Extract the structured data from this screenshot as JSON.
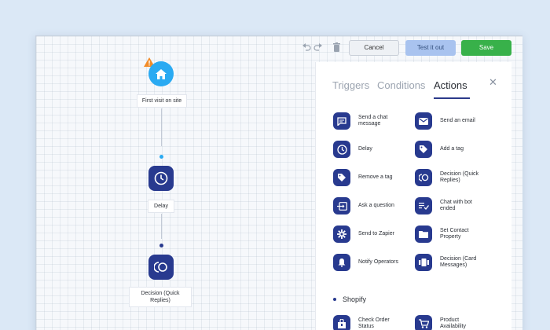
{
  "toolbar": {
    "undo_icon": "undo-icon",
    "redo_icon": "redo-icon",
    "trash_icon": "trash-icon",
    "cancel_label": "Cancel",
    "test_label": "Test it out",
    "save_label": "Save"
  },
  "flow": {
    "start_node": {
      "icon": "home-icon",
      "label": "First visit on site"
    },
    "delay_node": {
      "icon": "clock-icon",
      "label": "Delay"
    },
    "decision_node": {
      "icon": "decision-icon",
      "label_line1": "Decision (Quick",
      "label_line2": "Replies)"
    }
  },
  "panel": {
    "tabs": [
      {
        "label": "Triggers"
      },
      {
        "label": "Conditions"
      },
      {
        "label": "Actions",
        "active": true
      }
    ],
    "actions": [
      {
        "icon": "chat-icon",
        "line1": "Send a chat",
        "line2": "message"
      },
      {
        "icon": "email-icon",
        "line1": "Send an email",
        "line2": ""
      },
      {
        "icon": "clock-icon",
        "line1": "Delay",
        "line2": ""
      },
      {
        "icon": "tag-icon",
        "line1": "Add a tag",
        "line2": ""
      },
      {
        "icon": "tag-remove-icon",
        "line1": "Remove a tag",
        "line2": ""
      },
      {
        "icon": "decision-icon",
        "line1": "Decision (Quick",
        "line2": "Replies)"
      },
      {
        "icon": "question-icon",
        "line1": "Ask a question",
        "line2": ""
      },
      {
        "icon": "chat-bot-ended-icon",
        "line1": "Chat with bot",
        "line2": "ended"
      },
      {
        "icon": "zapier-icon",
        "line1": "Send to Zapier",
        "line2": ""
      },
      {
        "icon": "folder-icon",
        "line1": "Set Contact",
        "line2": "Property"
      },
      {
        "icon": "bell-icon",
        "line1": "Notify Operators",
        "line2": ""
      },
      {
        "icon": "cards-icon",
        "line1": "Decision (Card",
        "line2": "Messages)"
      }
    ],
    "section_title": "Shopify",
    "shopify_actions": [
      {
        "icon": "order-status-icon",
        "line1": "Check Order",
        "line2": "Status"
      },
      {
        "icon": "cart-icon",
        "line1": "Product",
        "line2": "Availability"
      }
    ]
  },
  "colors": {
    "background": "#dbe8f6",
    "accent_navy": "#283a8f",
    "home_node": "#2aaaf2",
    "save_green": "#38b14a",
    "test_blue": "#a9c3ef",
    "arrow_red": "#d72a45",
    "warning_orange": "#f28c28"
  }
}
